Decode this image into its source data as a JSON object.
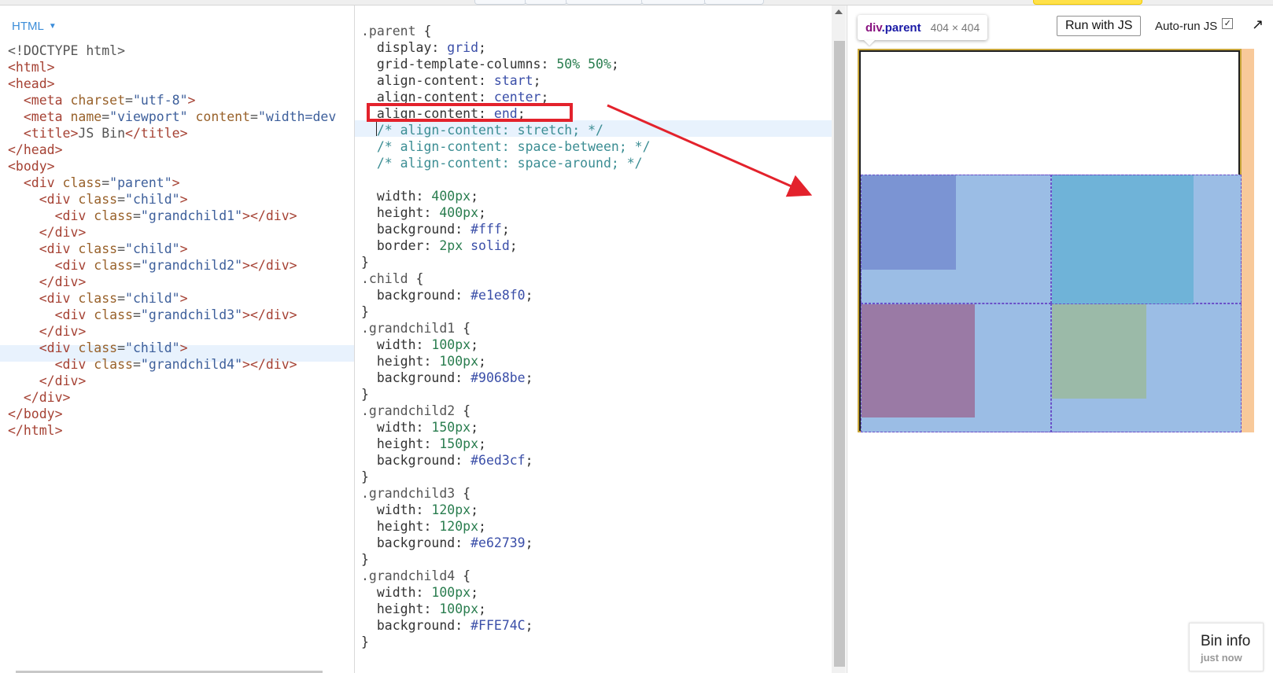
{
  "colors": {
    "accent_blue": "#3c8dd9",
    "highlight_red": "#e3222c",
    "child": "#e1e8f0",
    "grandchild1": "#9068be",
    "grandchild2": "#6ed3cf",
    "grandchild3": "#e62739",
    "grandchild4": "#FFE74C"
  },
  "html_panel": {
    "label": "HTML",
    "lines": [
      [
        [
          "p",
          "<!DOCTYPE html>"
        ]
      ],
      [
        [
          "t",
          "<html>"
        ]
      ],
      [
        [
          "t",
          "<head>"
        ]
      ],
      [
        [
          "p",
          "  "
        ],
        [
          "t",
          "<meta "
        ],
        [
          "a",
          "charset"
        ],
        [
          "p",
          "="
        ],
        [
          "s",
          "\"utf-8\""
        ],
        [
          "t",
          ">"
        ]
      ],
      [
        [
          "p",
          "  "
        ],
        [
          "t",
          "<meta "
        ],
        [
          "a",
          "name"
        ],
        [
          "p",
          "="
        ],
        [
          "s",
          "\"viewport\""
        ],
        [
          "p",
          " "
        ],
        [
          "a",
          "content"
        ],
        [
          "p",
          "="
        ],
        [
          "s",
          "\"width=dev"
        ]
      ],
      [
        [
          "p",
          "  "
        ],
        [
          "t",
          "<title>"
        ],
        [
          "p",
          "JS Bin"
        ],
        [
          "t",
          "</title>"
        ]
      ],
      [
        [
          "t",
          "</head>"
        ]
      ],
      [
        [
          "t",
          "<body>"
        ]
      ],
      [
        [
          "p",
          "  "
        ],
        [
          "t",
          "<div "
        ],
        [
          "a",
          "class"
        ],
        [
          "p",
          "="
        ],
        [
          "s",
          "\"parent\""
        ],
        [
          "t",
          ">"
        ]
      ],
      [
        [
          "p",
          "    "
        ],
        [
          "t",
          "<div "
        ],
        [
          "a",
          "class"
        ],
        [
          "p",
          "="
        ],
        [
          "s",
          "\"child\""
        ],
        [
          "t",
          ">"
        ]
      ],
      [
        [
          "p",
          "      "
        ],
        [
          "t",
          "<div "
        ],
        [
          "a",
          "class"
        ],
        [
          "p",
          "="
        ],
        [
          "s",
          "\"grandchild1\""
        ],
        [
          "t",
          "></div>"
        ]
      ],
      [
        [
          "p",
          "    "
        ],
        [
          "t",
          "</div>"
        ]
      ],
      [
        [
          "p",
          "    "
        ],
        [
          "t",
          "<div "
        ],
        [
          "a",
          "class"
        ],
        [
          "p",
          "="
        ],
        [
          "s",
          "\"child\""
        ],
        [
          "t",
          ">"
        ]
      ],
      [
        [
          "p",
          "      "
        ],
        [
          "t",
          "<div "
        ],
        [
          "a",
          "class"
        ],
        [
          "p",
          "="
        ],
        [
          "s",
          "\"grandchild2\""
        ],
        [
          "t",
          "></div>"
        ]
      ],
      [
        [
          "p",
          "    "
        ],
        [
          "t",
          "</div>"
        ]
      ],
      [
        [
          "p",
          "    "
        ],
        [
          "t",
          "<div "
        ],
        [
          "a",
          "class"
        ],
        [
          "p",
          "="
        ],
        [
          "s",
          "\"child\""
        ],
        [
          "t",
          ">"
        ]
      ],
      [
        [
          "p",
          "      "
        ],
        [
          "t",
          "<div "
        ],
        [
          "a",
          "class"
        ],
        [
          "p",
          "="
        ],
        [
          "s",
          "\"grandchild3\""
        ],
        [
          "t",
          "></div>"
        ]
      ],
      [
        [
          "p",
          "    "
        ],
        [
          "t",
          "</div>"
        ]
      ],
      [
        [
          "p",
          "    "
        ],
        [
          "t",
          "<div "
        ],
        [
          "a",
          "class"
        ],
        [
          "p",
          "="
        ],
        [
          "s",
          "\"child\""
        ],
        [
          "t",
          ">"
        ]
      ],
      [
        [
          "p",
          "      "
        ],
        [
          "t",
          "<div "
        ],
        [
          "a",
          "class"
        ],
        [
          "p",
          "="
        ],
        [
          "s",
          "\"grandchild4\""
        ],
        [
          "t",
          "></div>"
        ]
      ],
      [
        [
          "p",
          "    "
        ],
        [
          "t",
          "</div>"
        ]
      ],
      [
        [
          "p",
          "  "
        ],
        [
          "t",
          "</div>"
        ]
      ],
      [
        [
          "t",
          "</body>"
        ]
      ],
      [
        [
          "t",
          "</html>"
        ]
      ]
    ],
    "highlighted_line": 19
  },
  "css_panel": {
    "lines": [
      [
        [
          "sel",
          ".parent "
        ],
        [
          "prop",
          "{"
        ]
      ],
      [
        [
          "prop",
          "  display: "
        ],
        [
          "kw",
          "grid"
        ],
        [
          "prop",
          ";"
        ]
      ],
      [
        [
          "prop",
          "  grid-template-columns: "
        ],
        [
          "num",
          "50% 50%"
        ],
        [
          "prop",
          ";"
        ]
      ],
      [
        [
          "prop",
          "  align-content: "
        ],
        [
          "kw",
          "start"
        ],
        [
          "prop",
          ";"
        ]
      ],
      [
        [
          "prop",
          "  align-content: "
        ],
        [
          "kw",
          "center"
        ],
        [
          "prop",
          ";"
        ]
      ],
      [
        [
          "prop",
          "  align-content: "
        ],
        [
          "kw",
          "end"
        ],
        [
          "prop",
          ";"
        ]
      ],
      [
        [
          "cm",
          "  /* align-content: stretch; */"
        ]
      ],
      [
        [
          "cm",
          "  /* align-content: space-between; */"
        ]
      ],
      [
        [
          "cm",
          "  /* align-content: space-around; */"
        ]
      ],
      [
        [
          "prop",
          ""
        ]
      ],
      [
        [
          "prop",
          "  width: "
        ],
        [
          "num",
          "400px"
        ],
        [
          "prop",
          ";"
        ]
      ],
      [
        [
          "prop",
          "  height: "
        ],
        [
          "num",
          "400px"
        ],
        [
          "prop",
          ";"
        ]
      ],
      [
        [
          "prop",
          "  background: "
        ],
        [
          "kw",
          "#fff"
        ],
        [
          "prop",
          ";"
        ]
      ],
      [
        [
          "prop",
          "  border: "
        ],
        [
          "num",
          "2px"
        ],
        [
          "prop",
          " "
        ],
        [
          "kw",
          "solid"
        ],
        [
          "prop",
          ";"
        ]
      ],
      [
        [
          "prop",
          "}"
        ]
      ],
      [
        [
          "sel",
          ".child "
        ],
        [
          "prop",
          "{"
        ]
      ],
      [
        [
          "prop",
          "  background: "
        ],
        [
          "kw",
          "#e1e8f0"
        ],
        [
          "prop",
          ";"
        ]
      ],
      [
        [
          "prop",
          "}"
        ]
      ],
      [
        [
          "sel",
          ".grandchild1 "
        ],
        [
          "prop",
          "{"
        ]
      ],
      [
        [
          "prop",
          "  width: "
        ],
        [
          "num",
          "100px"
        ],
        [
          "prop",
          ";"
        ]
      ],
      [
        [
          "prop",
          "  height: "
        ],
        [
          "num",
          "100px"
        ],
        [
          "prop",
          ";"
        ]
      ],
      [
        [
          "prop",
          "  background: "
        ],
        [
          "kw",
          "#9068be"
        ],
        [
          "prop",
          ";"
        ]
      ],
      [
        [
          "prop",
          "}"
        ]
      ],
      [
        [
          "sel",
          ".grandchild2 "
        ],
        [
          "prop",
          "{"
        ]
      ],
      [
        [
          "prop",
          "  width: "
        ],
        [
          "num",
          "150px"
        ],
        [
          "prop",
          ";"
        ]
      ],
      [
        [
          "prop",
          "  height: "
        ],
        [
          "num",
          "150px"
        ],
        [
          "prop",
          ";"
        ]
      ],
      [
        [
          "prop",
          "  background: "
        ],
        [
          "kw",
          "#6ed3cf"
        ],
        [
          "prop",
          ";"
        ]
      ],
      [
        [
          "prop",
          "}"
        ]
      ],
      [
        [
          "sel",
          ".grandchild3 "
        ],
        [
          "prop",
          "{"
        ]
      ],
      [
        [
          "prop",
          "  width: "
        ],
        [
          "num",
          "120px"
        ],
        [
          "prop",
          ";"
        ]
      ],
      [
        [
          "prop",
          "  height: "
        ],
        [
          "num",
          "120px"
        ],
        [
          "prop",
          ";"
        ]
      ],
      [
        [
          "prop",
          "  background: "
        ],
        [
          "kw",
          "#e62739"
        ],
        [
          "prop",
          ";"
        ]
      ],
      [
        [
          "prop",
          "}"
        ]
      ],
      [
        [
          "sel",
          ".grandchild4 "
        ],
        [
          "prop",
          "{"
        ]
      ],
      [
        [
          "prop",
          "  width: "
        ],
        [
          "num",
          "100px"
        ],
        [
          "prop",
          ";"
        ]
      ],
      [
        [
          "prop",
          "  height: "
        ],
        [
          "num",
          "100px"
        ],
        [
          "prop",
          ";"
        ]
      ],
      [
        [
          "prop",
          "  background: "
        ],
        [
          "kw",
          "#FFE74C"
        ],
        [
          "prop",
          ";"
        ]
      ],
      [
        [
          "prop",
          "}"
        ]
      ]
    ],
    "boxed_line": 5
  },
  "output_panel": {
    "tooltip_element": "div",
    "tooltip_class": ".parent",
    "tooltip_dims": "404 × 404",
    "run_button": "Run with JS",
    "autorun_label": "Auto-run JS",
    "autorun_check": "✓",
    "popout_icon": "↗",
    "cells": [
      {
        "name": "grandchild1",
        "fill": "#7b94d3"
      },
      {
        "name": "grandchild2",
        "fill": "#6fb3d8"
      },
      {
        "name": "grandchild3",
        "fill": "#9a7aa5"
      },
      {
        "name": "grandchild4",
        "fill": "#9bbaa8"
      }
    ]
  },
  "bin_info": {
    "title": "Bin info",
    "subtitle": "just now"
  }
}
